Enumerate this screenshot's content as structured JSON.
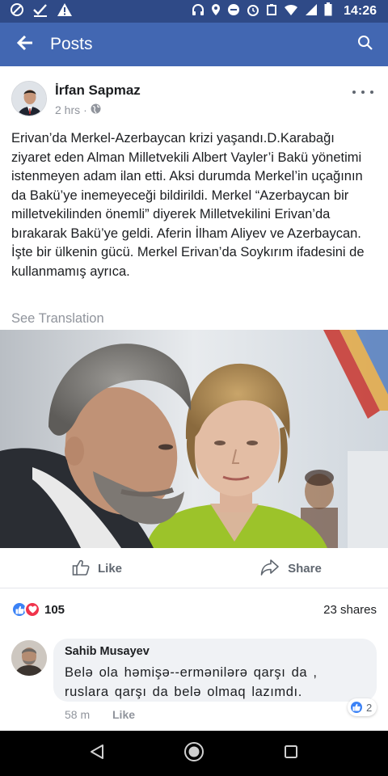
{
  "status_bar": {
    "time": "14:26",
    "icons_left": [
      "data-saver-icon",
      "check-icon",
      "warning-icon"
    ],
    "icons_right": [
      "headphones-icon",
      "location-icon",
      "minus-circle-icon",
      "alarm-icon",
      "notification-icon",
      "wifi-icon",
      "signal-icon",
      "battery-icon"
    ]
  },
  "app_bar": {
    "title": "Posts",
    "back_icon": "arrow-back-icon",
    "search_icon": "search-icon",
    "color": "#4267b2"
  },
  "post": {
    "author": "İrfan Sapmaz",
    "time": "2 hrs",
    "separator": "·",
    "audience_icon": "globe-icon",
    "text": "Erivan’da Merkel-Azerbaycan krizi yaşandı.D.Karabağı ziyaret eden Alman Milletvekili Albert Vayler’i Bakü yönetimi istenmeyen adam ilan etti. Aksi durumda Merkel’in uçağının da Bakü’ye inemeyeceği bildirildi. Merkel “Azerbaycan bir milletvekilinden önemli” diyerek Milletvekilini Erivan’da bırakarak Bakü’ye geldi. Aferin İlham Aliyev ve Azerbaycan. İşte bir ülkenin gücü. Merkel Erivan’da Soykırım ifadesini de kullanmamış ayrıca.",
    "see_translation": "See Translation",
    "actions": {
      "like": "Like",
      "share": "Share"
    },
    "reactions": {
      "count": "105",
      "types": [
        "like",
        "love"
      ]
    },
    "shares": "23 shares"
  },
  "comment": {
    "author": "Sahib Musayev",
    "text": "Belə ola həmişə--ermənilərə qarşı da , ruslara qarşı da belə olmaq lazımdı.",
    "time": "58 m",
    "like_label": "Like",
    "reaction_count": "2"
  },
  "nav_bar": {
    "buttons": [
      "back-triangle-icon",
      "home-circle-icon",
      "recents-square-icon"
    ]
  }
}
